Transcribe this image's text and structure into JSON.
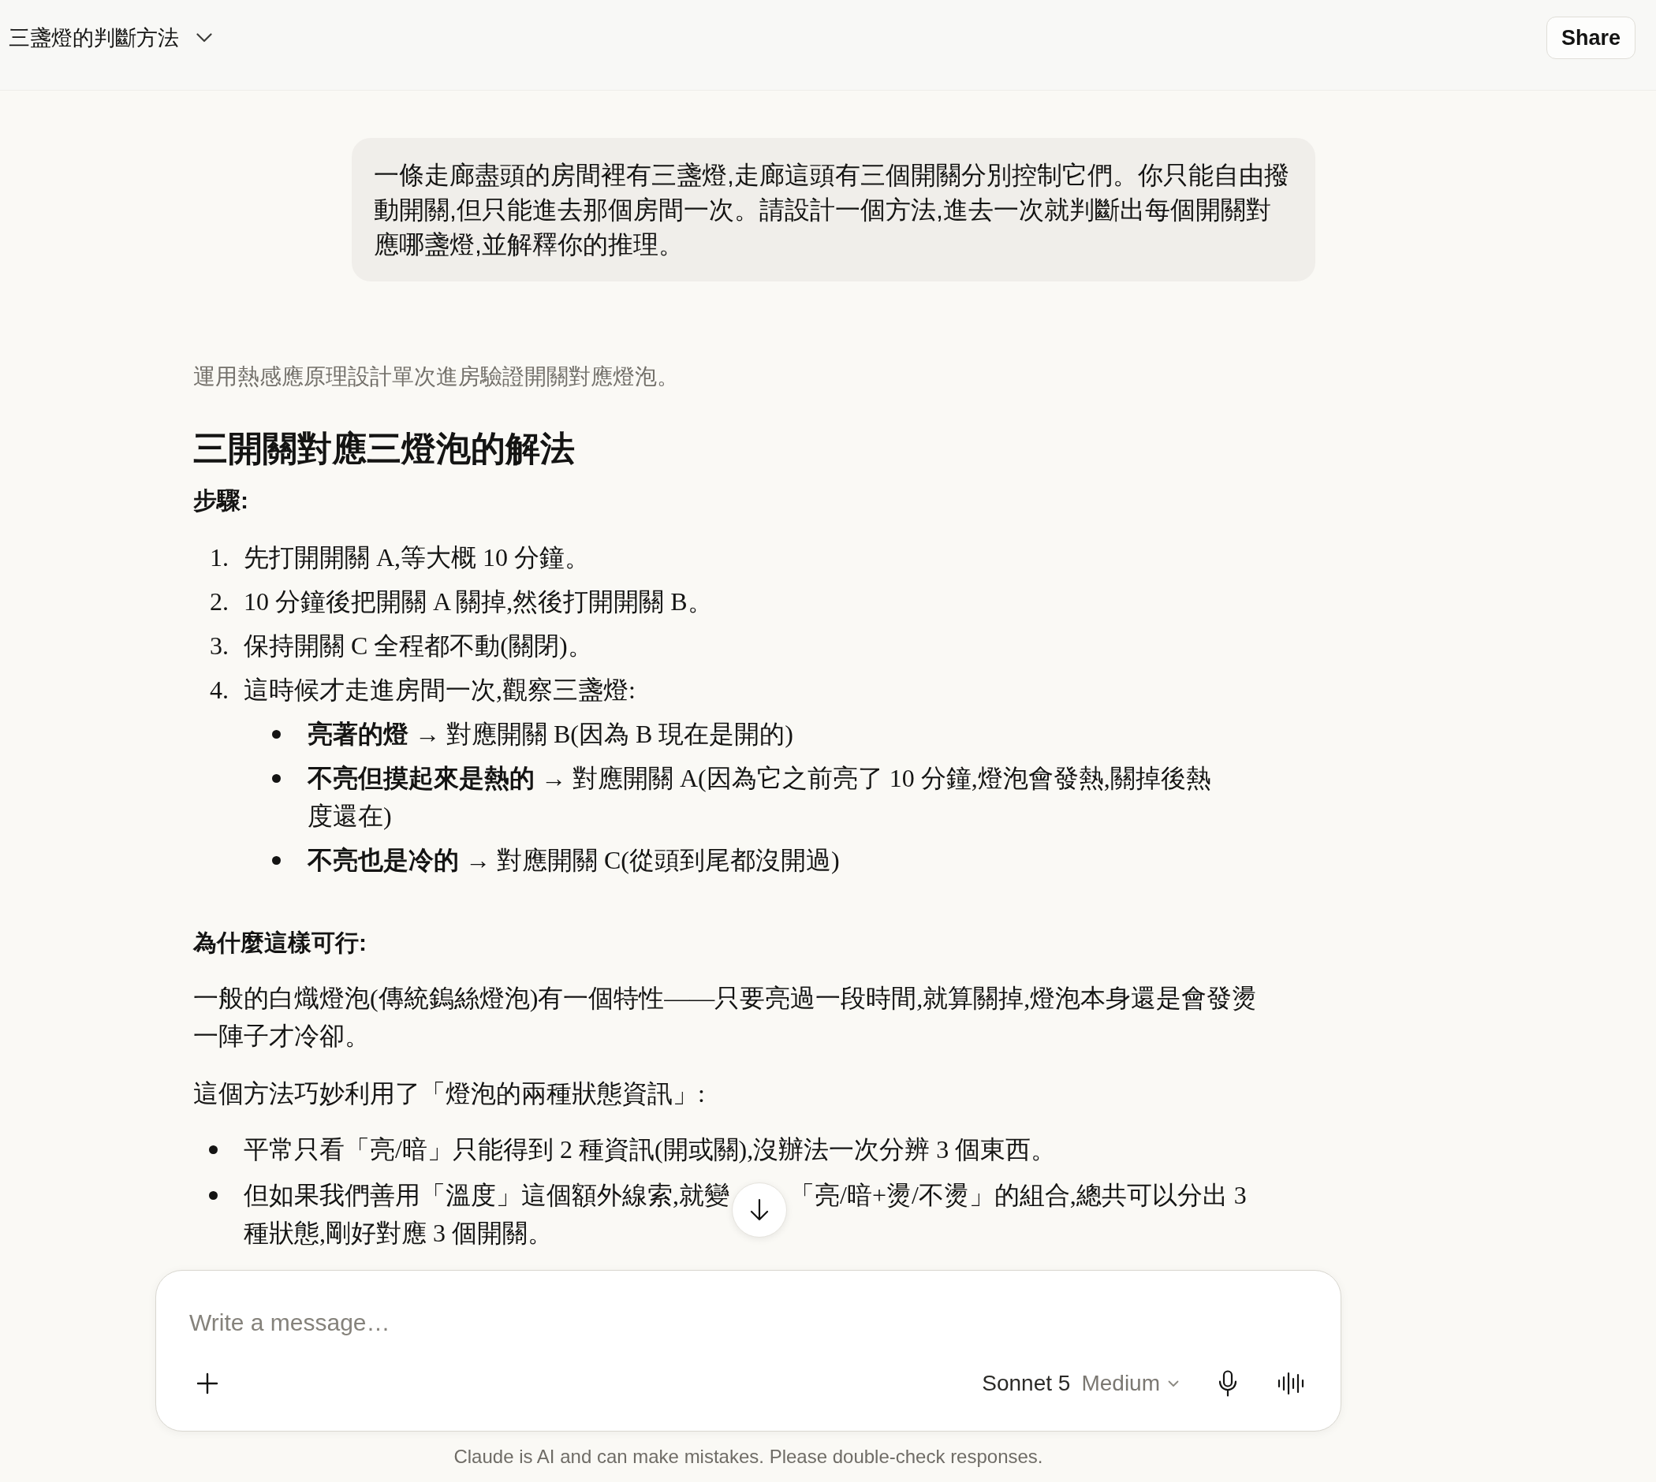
{
  "header": {
    "title": "三盞燈的判斷方法",
    "share_label": "Share"
  },
  "user_message": {
    "text": "一條走廊盡頭的房間裡有三盞燈,走廊這頭有三個開關分別控制它們。你只能自由撥動開關,但只能進去那個房間一次。請設計一個方法,進去一次就判斷出每個開關對應哪盞燈,並解釋你的推理。"
  },
  "response": {
    "summary": "運用熱感應原理設計單次進房驗證開關對應燈泡。",
    "heading": "三開關對應三燈泡的解法",
    "steps_label": "步驟:",
    "steps": [
      {
        "number": "1.",
        "text": "先打開開關 A,等大概 10 分鐘。"
      },
      {
        "number": "2.",
        "text": "10 分鐘後把開關 A 關掉,然後打開開關 B。"
      },
      {
        "number": "3.",
        "text": "保持開關 C 全程都不動(關閉)。"
      },
      {
        "number": "4.",
        "text": "這時候才走進房間一次,觀察三盞燈:",
        "sub_items": [
          {
            "text": "**亮著的燈** → 對應開關 B(因為 B 現在是開的)"
          },
          {
            "text": "**不亮但摸起來是熱的** → 對應開關 A(因為它之前亮了 10 分鐘,燈泡會發熱,關掉後熱度還在)"
          },
          {
            "text": "**不亮也是冷的** → 對應開關 C(從頭到尾都沒開過)"
          }
        ]
      }
    ],
    "why_label": "為什麼這樣可行:",
    "paragraphs": [
      "一般的白熾燈泡(傳統鎢絲燈泡)有一個特性——只要亮過一段時間,就算關掉,燈泡本身還是會發燙一陣子才冷卻。",
      "這個方法巧妙利用了「燈泡的兩種狀態資訊」:"
    ],
    "points": [
      {
        "lines": [
          [
            "平常只看「亮/暗」只能得到 2 種資訊(開或關),沒辦法一次分辨 3 個東西。"
          ]
        ]
      },
      {
        "lines": [
          [
            "但如果我們善用「溫度」這個額外線索,就變",
            "「亮/暗+燙/不燙」的組合,總共可以分出 3"
          ],
          [
            "種狀態,剛好對應 3 個開關。"
          ]
        ]
      }
    ]
  },
  "composer": {
    "placeholder": "Write a message…",
    "model": "Sonnet 5",
    "effort": "Medium"
  },
  "disclaimer": "Claude is AI and can make mistakes. Please double-check responses."
}
